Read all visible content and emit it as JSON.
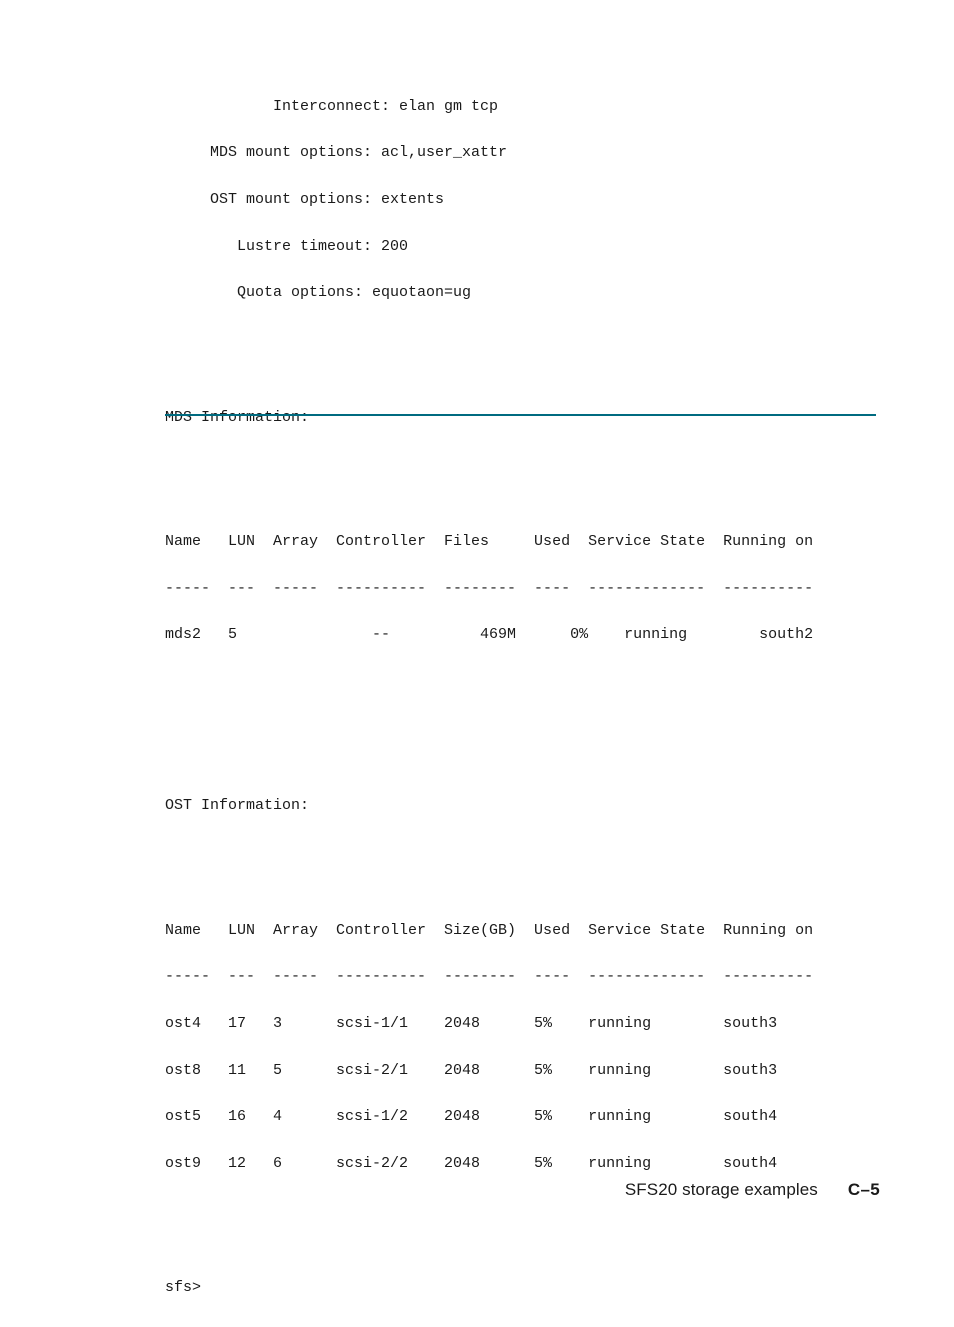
{
  "page": {
    "terminal_output": {
      "summary_block": [
        "            Interconnect: elan gm tcp",
        "     MDS mount options: acl,user_xattr",
        "     OST mount options: extents",
        "        Lustre timeout: 200",
        "        Quota options: equotaon=ug"
      ],
      "summary_fields": [
        {
          "label": "Interconnect",
          "value": "elan gm tcp"
        },
        {
          "label": "MDS mount options",
          "value": "acl,user_xattr"
        },
        {
          "label": "OST mount options",
          "value": "extents"
        },
        {
          "label": "Lustre timeout",
          "value": "200"
        },
        {
          "label": "Quota options",
          "value": "equotaon=ug"
        }
      ],
      "mds_section": {
        "heading": "MDS Information:",
        "header_line": "Name   LUN  Array  Controller  Files     Used  Service State  Running on",
        "separator_line": "-----  ---  -----  ----------  --------  ----  -------------  ----------",
        "columns": [
          "Name",
          "LUN",
          "Array",
          "Controller",
          "Files",
          "Used",
          "Service State",
          "Running on"
        ],
        "rows": [
          {
            "line": "mds2   5               --          469M      0%    running        south2",
            "Name": "mds2",
            "LUN": "5",
            "Array": "",
            "Controller": "--",
            "Files": "469M",
            "Used": "0%",
            "Service State": "running",
            "Running on": "south2"
          }
        ]
      },
      "ost_section": {
        "heading": "OST Information:",
        "header_line": "Name   LUN  Array  Controller  Size(GB)  Used  Service State  Running on",
        "separator_line": "-----  ---  -----  ----------  --------  ----  -------------  ----------",
        "columns": [
          "Name",
          "LUN",
          "Array",
          "Controller",
          "Size(GB)",
          "Used",
          "Service State",
          "Running on"
        ],
        "rows": [
          {
            "line": "ost4   17   3      scsi-1/1    2048      5%    running        south3",
            "Name": "ost4",
            "LUN": "17",
            "Array": "3",
            "Controller": "scsi-1/1",
            "Size(GB)": "2048",
            "Used": "5%",
            "Service State": "running",
            "Running on": "south3"
          },
          {
            "line": "ost8   11   5      scsi-2/1    2048      5%    running        south3",
            "Name": "ost8",
            "LUN": "11",
            "Array": "5",
            "Controller": "scsi-2/1",
            "Size(GB)": "2048",
            "Used": "5%",
            "Service State": "running",
            "Running on": "south3"
          },
          {
            "line": "ost5   16   4      scsi-1/2    2048      5%    running        south4",
            "Name": "ost5",
            "LUN": "16",
            "Array": "4",
            "Controller": "scsi-1/2",
            "Size(GB)": "2048",
            "Used": "5%",
            "Service State": "running",
            "Running on": "south4"
          },
          {
            "line": "ost9   12   6      scsi-2/2    2048      5%    running        south4",
            "Name": "ost9",
            "LUN": "12",
            "Array": "6",
            "Controller": "scsi-2/2",
            "Size(GB)": "2048",
            "Used": "5%",
            "Service State": "running",
            "Running on": "south4"
          }
        ]
      },
      "prompt": "sfs>"
    },
    "footer": {
      "title": "SFS20 storage examples",
      "page_number": "C–5"
    },
    "colors": {
      "rule": "#006b80",
      "text": "#1a1a1a"
    }
  }
}
